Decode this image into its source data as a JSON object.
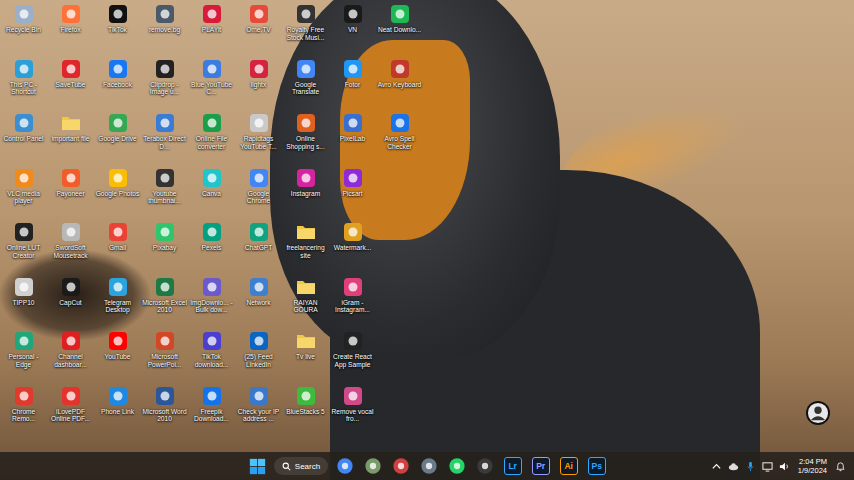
{
  "desktop": {
    "icons": [
      {
        "label": "Recycle Bin",
        "kind": "app",
        "color": "#9ab0c8"
      },
      {
        "label": "This PC - Shortcut",
        "kind": "app",
        "color": "#2a9fd8"
      },
      {
        "label": "Control Panel",
        "kind": "app",
        "color": "#3b8fd0"
      },
      {
        "label": "VLC media player",
        "kind": "app",
        "color": "#f08a1c"
      },
      {
        "label": "Online LUT Creator",
        "kind": "app",
        "color": "#222222"
      },
      {
        "label": "TIPP10",
        "kind": "app",
        "color": "#d0d0d0"
      },
      {
        "label": "Personal - Edge",
        "kind": "app",
        "color": "#1fa67a"
      },
      {
        "label": "Chrome Remo...",
        "kind": "app",
        "color": "#e03a2f"
      },
      {
        "label": "Firefox",
        "kind": "app",
        "color": "#ff7139"
      },
      {
        "label": "SaveTube",
        "kind": "app",
        "color": "#e0262a"
      },
      {
        "label": "important file",
        "kind": "folder",
        "color": "#f2c744"
      },
      {
        "label": "Payoneer",
        "kind": "app",
        "color": "#f25c2a"
      },
      {
        "label": "SwordSoft Mousetrack",
        "kind": "app",
        "color": "#b8b8b8"
      },
      {
        "label": "CapCut",
        "kind": "app",
        "color": "#1a1a1a"
      },
      {
        "label": "Channel dashboar...",
        "kind": "app",
        "color": "#e02020"
      },
      {
        "label": "iLovePDF Online PDF...",
        "kind": "app",
        "color": "#e5322d"
      },
      {
        "label": "TikTok",
        "kind": "app",
        "color": "#111111"
      },
      {
        "label": "Facebook",
        "kind": "app",
        "color": "#1877f2"
      },
      {
        "label": "Google Drive",
        "kind": "app",
        "color": "#34a853"
      },
      {
        "label": "Google Photos",
        "kind": "app",
        "color": "#fbbc04"
      },
      {
        "label": "Gmail",
        "kind": "app",
        "color": "#ea4335"
      },
      {
        "label": "Telegram Desktop",
        "kind": "app",
        "color": "#2aa3df"
      },
      {
        "label": "YouTube",
        "kind": "app",
        "color": "#ff0000"
      },
      {
        "label": "Phone Link",
        "kind": "app",
        "color": "#1e88e5"
      },
      {
        "label": "remove.bg",
        "kind": "app",
        "color": "#4a5a6a"
      },
      {
        "label": "Clipdrop - Image u...",
        "kind": "app",
        "color": "#222222"
      },
      {
        "label": "Terabox Direct D...",
        "kind": "app",
        "color": "#3a7bd5"
      },
      {
        "label": "Youtube thumbnai...",
        "kind": "app",
        "color": "#333333"
      },
      {
        "label": "Pixabay",
        "kind": "app",
        "color": "#2ec66d"
      },
      {
        "label": "Microsoft Excel 2010",
        "kind": "app",
        "color": "#1e7a44"
      },
      {
        "label": "Microsoft PowerPoi...",
        "kind": "app",
        "color": "#d24726"
      },
      {
        "label": "Microsoft Word 2010",
        "kind": "app",
        "color": "#2b579a"
      },
      {
        "label": "PLAYit",
        "kind": "app",
        "color": "#d81b3a"
      },
      {
        "label": "Blue YouTube C...",
        "kind": "app",
        "color": "#3c7be0"
      },
      {
        "label": "Online File converter",
        "kind": "app",
        "color": "#1a9e4a"
      },
      {
        "label": "Canva",
        "kind": "app",
        "color": "#20c4cb"
      },
      {
        "label": "Pexels",
        "kind": "app",
        "color": "#05a081"
      },
      {
        "label": "ImgDownlo... - Bulk dow...",
        "kind": "app",
        "color": "#6a5acd"
      },
      {
        "label": "TikTok download...",
        "kind": "app",
        "color": "#4b3fd0"
      },
      {
        "label": "Freepik Download...",
        "kind": "app",
        "color": "#1273eb"
      },
      {
        "label": "Ome.TV",
        "kind": "app",
        "color": "#e84a3a"
      },
      {
        "label": "lightx",
        "kind": "app",
        "color": "#d3233f"
      },
      {
        "label": "Rapidtags YouTube T...",
        "kind": "app",
        "color": "#c9c9c9"
      },
      {
        "label": "Google Chrome",
        "kind": "app",
        "color": "#4285f4"
      },
      {
        "label": "ChatGPT",
        "kind": "app",
        "color": "#10a37f"
      },
      {
        "label": "Network",
        "kind": "app",
        "color": "#3f7fd0"
      },
      {
        "label": "(25) Feed LinkedIn",
        "kind": "app",
        "color": "#0a66c2"
      },
      {
        "label": "Check your IP address ...",
        "kind": "app",
        "color": "#3a79c9"
      },
      {
        "label": "Royalty Free Stock Musi...",
        "kind": "app",
        "color": "#333333"
      },
      {
        "label": "Google Translate",
        "kind": "app",
        "color": "#4285f4"
      },
      {
        "label": "Online Shopping s...",
        "kind": "app",
        "color": "#e06020"
      },
      {
        "label": "Instagram",
        "kind": "app",
        "color": "#d6249f"
      },
      {
        "label": "freelancering site",
        "kind": "folder",
        "color": "#f2c744"
      },
      {
        "label": "RAIYAN GOURA",
        "kind": "folder",
        "color": "#f2c744"
      },
      {
        "label": "Tv live",
        "kind": "folder",
        "color": "#f2c744"
      },
      {
        "label": "BlueStacks 5",
        "kind": "app",
        "color": "#3dbb3d"
      },
      {
        "label": "VN",
        "kind": "app",
        "color": "#1a1a1a"
      },
      {
        "label": "Fotor",
        "kind": "app",
        "color": "#2196f3"
      },
      {
        "label": "PixelLab",
        "kind": "app",
        "color": "#3a6fd0"
      },
      {
        "label": "Picsart",
        "kind": "app",
        "color": "#8e2bd6"
      },
      {
        "label": "Watermark...",
        "kind": "app",
        "color": "#e0a020"
      },
      {
        "label": "iGram - Instagram...",
        "kind": "app",
        "color": "#e0407a"
      },
      {
        "label": "Create React App Sample",
        "kind": "app",
        "color": "#222222"
      },
      {
        "label": "Remove vocal fro...",
        "kind": "app",
        "color": "#d04a8a"
      },
      {
        "label": "Neat Downlo...",
        "kind": "app",
        "color": "#1db954"
      },
      {
        "label": "Avro Keyboard",
        "kind": "app",
        "color": "#c0392b"
      },
      {
        "label": "Avro Spell Checker",
        "kind": "app",
        "color": "#1a73e8"
      }
    ]
  },
  "taskbar": {
    "search": {
      "placeholder": "Search"
    },
    "apps": [
      {
        "glyph": "",
        "color": "#4285f4"
      },
      {
        "glyph": "",
        "color": "#7a9a6a"
      },
      {
        "glyph": "",
        "color": "#d04040"
      },
      {
        "glyph": "",
        "color": "#6a7a8a"
      },
      {
        "glyph": "",
        "color": "#25d366"
      },
      {
        "glyph": "",
        "color": "#3a3a3a"
      },
      {
        "glyph": "Lr",
        "color": "#31a8ff"
      },
      {
        "glyph": "Pr",
        "color": "#9999ff"
      },
      {
        "glyph": "Ai",
        "color": "#ff9a00"
      },
      {
        "glyph": "Ps",
        "color": "#31a8ff"
      }
    ],
    "clock": {
      "time": "2:04 PM",
      "date": "1/9/2024"
    }
  }
}
